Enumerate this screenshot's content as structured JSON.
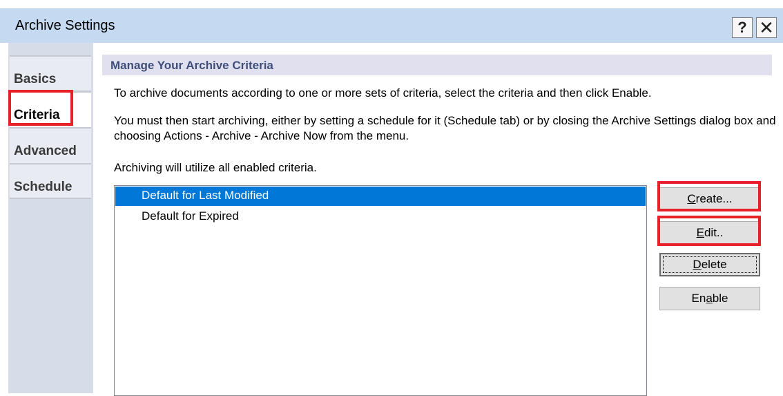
{
  "window": {
    "title": "Archive Settings",
    "help_glyph": "?",
    "close_glyph": "✕"
  },
  "tabs": [
    {
      "label": "Basics",
      "active": false
    },
    {
      "label": "Criteria",
      "active": true
    },
    {
      "label": "Advanced",
      "active": false
    },
    {
      "label": "Schedule",
      "active": false
    }
  ],
  "section": {
    "title": "Manage Your Archive Criteria"
  },
  "instructions": {
    "line1": "To archive documents according to one or more sets of criteria, select the criteria and then click Enable.",
    "line2": "You must then start archiving, either by setting a schedule for it (Schedule tab) or by closing the Archive Settings dialog box and choosing Actions - Archive - Archive Now from the menu.",
    "line3": "Archiving will utilize all enabled criteria."
  },
  "criteria_list": [
    {
      "label": "Default for Last Modified",
      "selected": true
    },
    {
      "label": "Default for Expired",
      "selected": false
    }
  ],
  "buttons": {
    "create": {
      "pre": "",
      "mnemonic": "C",
      "post": "reate..."
    },
    "edit": {
      "pre": "",
      "mnemonic": "E",
      "post": "dit.."
    },
    "delete": {
      "pre": "",
      "mnemonic": "D",
      "post": "elete"
    },
    "enable": {
      "pre": "En",
      "mnemonic": "a",
      "post": "ble"
    }
  },
  "colors": {
    "title_bar": "#c5d9f1",
    "selection": "#0078d7",
    "highlight_box": "#e8202a",
    "section_header": "#e0e0ee"
  }
}
